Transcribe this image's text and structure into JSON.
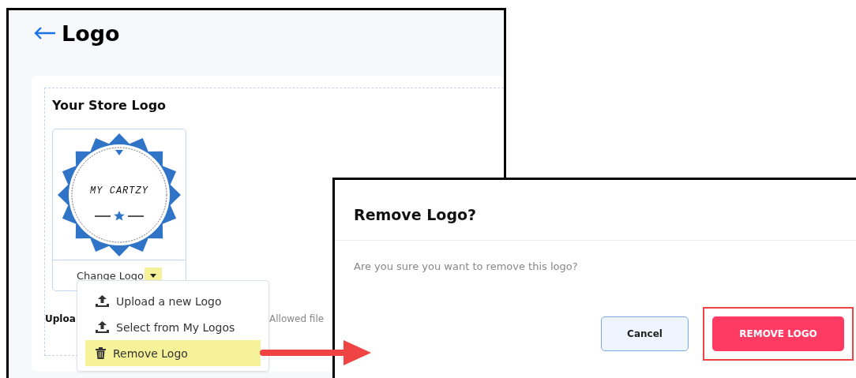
{
  "page": {
    "title": "Logo"
  },
  "logo_section": {
    "heading": "Your Store Logo",
    "logo_text": "MY CARTZY",
    "change_label": "Change Logo",
    "caret_highlighted": true,
    "upload_label": "Uploa",
    "allowed_text": "Allowed file"
  },
  "menu": [
    {
      "kind": "upload",
      "label": "Upload a new Logo",
      "highlighted": false
    },
    {
      "kind": "upload",
      "label": "Select from My Logos",
      "highlighted": false
    },
    {
      "kind": "trash",
      "label": "Remove Logo",
      "highlighted": true
    }
  ],
  "dialog": {
    "title": "Remove Logo?",
    "message": "Are you sure you want to remove this logo?",
    "buttons": [
      {
        "kind": "secondary",
        "label": "Cancel",
        "outlined": false
      },
      {
        "kind": "danger",
        "label": "REMOVE LOGO",
        "outlined": true
      }
    ]
  }
}
